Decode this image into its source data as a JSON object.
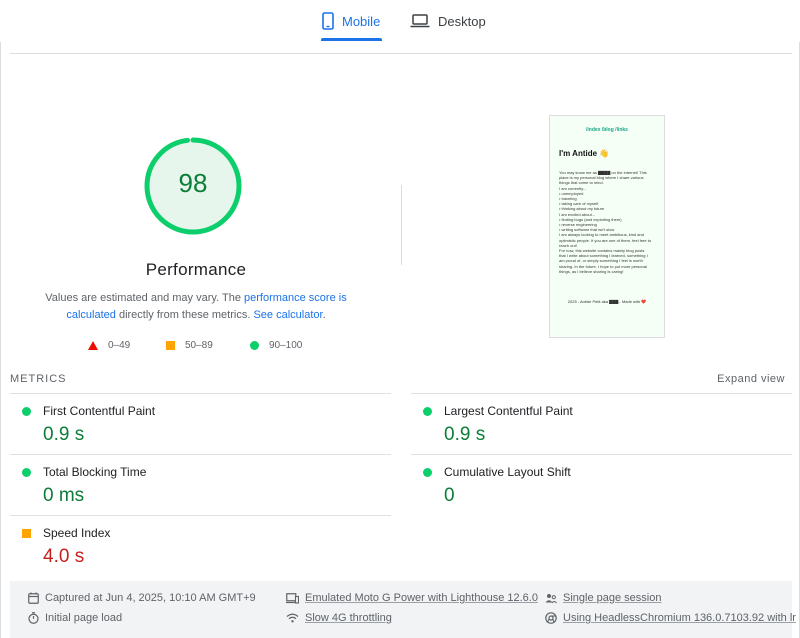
{
  "tabs": [
    {
      "label": "Mobile",
      "icon": "phone-icon",
      "selected": true
    },
    {
      "label": "Desktop",
      "icon": "laptop-icon",
      "selected": false
    }
  ],
  "gauge": {
    "score": "98",
    "label": "Performance",
    "color": "#0cce6b",
    "text_color": "#0c7d38"
  },
  "description": {
    "part1": "Values are estimated and may vary. The ",
    "link1": "performance score is calculated",
    "part2": " directly from these metrics. ",
    "link2": "See calculator",
    "part3": "."
  },
  "legend": [
    {
      "range": "0–49",
      "shape": "triangle",
      "color": "#eb0f00"
    },
    {
      "range": "50–89",
      "shape": "square",
      "color": "#ffa400"
    },
    {
      "range": "90–100",
      "shape": "circle",
      "color": "#0cce6b"
    }
  ],
  "preview": {
    "nav": "/index  /blog  /links",
    "title": "I'm Antide 👋",
    "lines": [
      "You may know me as ▇▇▇▇ on the internet! This",
      "place is my personal blog where I share various",
      "things that come to mind.",
      "I am currently...",
      " • unemployed",
      " • traveling",
      " • taking care of myself",
      " • thinking about my future",
      "I am excited about...",
      " • finding bugs (and exploiting them)",
      " • reverse engineering",
      " • writing software that isn't slow",
      "I am always looking to meet ambitious, kind and",
      "optimistic people. If you are one of them, feel free to",
      "reach out!",
      "For now, this website contains mainly blog posts",
      "that I write about something I learned, something I",
      "am proud of, or simply something I feel is worth",
      "sharing. In the future, I hope to put more personal",
      "things, as I believe sharing is caring!"
    ],
    "footer": "2025 - Antide Petit aka ▇▇▇ - Made with ❤️"
  },
  "metrics": {
    "heading": "METRICS",
    "expand_label": "Expand view",
    "items": [
      {
        "name": "First Contentful Paint",
        "value": "0.9 s",
        "rating": "good"
      },
      {
        "name": "Largest Contentful Paint",
        "value": "0.9 s",
        "rating": "good"
      },
      {
        "name": "Total Blocking Time",
        "value": "0 ms",
        "rating": "good"
      },
      {
        "name": "Cumulative Layout Shift",
        "value": "0",
        "rating": "good"
      },
      {
        "name": "Speed Index",
        "value": "4.0 s",
        "rating": "average"
      }
    ]
  },
  "footer": {
    "captured": "Captured at Jun 4, 2025, 10:10 AM GMT+9",
    "initial_load": "Initial page load",
    "emulated": "Emulated Moto G Power with Lighthouse 12.6.0",
    "throttling": "Slow 4G throttling",
    "session": "Single page session",
    "browser": "Using HeadlessChromium 136.0.7103.92 with lr"
  }
}
